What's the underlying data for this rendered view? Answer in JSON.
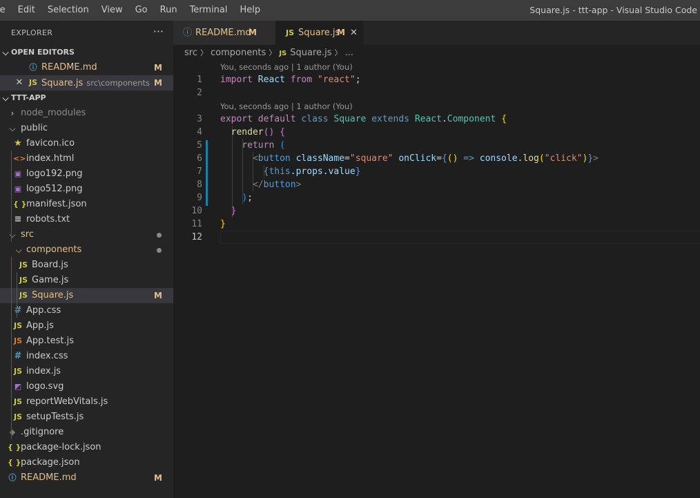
{
  "window_title": "Square.js - ttt-app - Visual Studio Code",
  "menu": [
    "le",
    "Edit",
    "Selection",
    "View",
    "Go",
    "Run",
    "Terminal",
    "Help"
  ],
  "sidebar": {
    "title": "EXPLORER",
    "more": "···",
    "open_editors_label": "OPEN EDITORS",
    "open_editors": [
      {
        "name": "README.md",
        "desc": "",
        "badge": "M",
        "icon": "info-icon"
      },
      {
        "name": "Square.js",
        "desc": "src\\components",
        "badge": "M",
        "icon": "js-icon"
      }
    ],
    "project_label": "TTT-APP",
    "tree": {
      "node_modules": "node_modules",
      "public": "public",
      "favicon": "favicon.ico",
      "index_html": "index.html",
      "logo192": "logo192.png",
      "logo512": "logo512.png",
      "manifest": "manifest.json",
      "robots": "robots.txt",
      "src": "src",
      "components": "components",
      "board": "Board.js",
      "game": "Game.js",
      "square": "Square.js",
      "square_badge": "M",
      "app_css": "App.css",
      "app_js": "App.js",
      "app_test": "App.test.js",
      "index_css": "index.css",
      "index_js": "index.js",
      "logo_svg": "logo.svg",
      "report": "reportWebVitals.js",
      "setup": "setupTests.js",
      "gitignore": ".gitignore",
      "package_lock": "package-lock.json",
      "package": "package.json",
      "readme": "README.md",
      "readme_badge": "M"
    },
    "icon_labels": {
      "js": "JS",
      "hash": "#",
      "json": "{ }",
      "html": "<>",
      "info": "i"
    }
  },
  "tabs": [
    {
      "label": "README.md",
      "badge": "M",
      "icon": "info-icon"
    },
    {
      "label": "Square.js",
      "badge": "M",
      "icon": "js-icon",
      "close": "✕"
    }
  ],
  "breadcrumb": [
    "src",
    "components",
    "Square.js",
    "..."
  ],
  "editor": {
    "codelens": "You, seconds ago | 1 author (You)",
    "line_numbers": [
      "1",
      "2",
      "3",
      "4",
      "5",
      "6",
      "7",
      "8",
      "9",
      "10",
      "11",
      "12"
    ],
    "tokens": {
      "import": "import",
      "React": "React",
      "from": "from",
      "react_str": "\"react\"",
      "semi": ";",
      "export": "export",
      "default": "default",
      "class": "class",
      "Square": "Square",
      "extends": "extends",
      "React2": "React",
      "dot": ".",
      "Component": "Component",
      "lbrace": "{",
      "render": "render",
      "parens": "()",
      "return": "return",
      "lparen": "(",
      "lt": "<",
      "button": "button",
      "className": "className",
      "eq": "=",
      "square_str": "\"square\"",
      "onClick": "onClick",
      "arrow_open": "{",
      "arrow_parens": "()",
      "arrow": "=>",
      "console": "console",
      "log": "log",
      "click_str": "\"click\"",
      "gt": ">",
      "this": "this",
      "props": "props",
      "value": "value",
      "close_tag_open": "</",
      "rparen": ")",
      "rbrace": "}"
    }
  },
  "colors": {
    "accent": "#1b81a8",
    "modified": "#e2c08d",
    "js": "#cbcb41",
    "json": "#cbcb41",
    "html": "#e37933",
    "css": "#519aba",
    "image": "#a074c4",
    "gitignore": "#41535b"
  }
}
